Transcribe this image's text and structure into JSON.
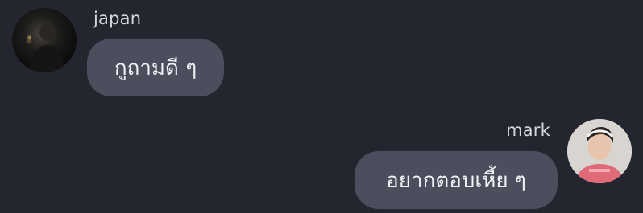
{
  "chat": {
    "messages": [
      {
        "sender": "japan",
        "side": "left",
        "text": "กูถามดี ๆ",
        "avatar_icon": "user-avatar-dark-photo"
      },
      {
        "sender": "mark",
        "side": "right",
        "text": "อยากตอบเหี้ย ๆ",
        "avatar_icon": "user-avatar-portrait-photo"
      }
    ]
  },
  "colors": {
    "background": "#23262f",
    "bubble": "#4b4f5d",
    "text": "#f1f2f5",
    "sender": "#d4d6dc"
  }
}
